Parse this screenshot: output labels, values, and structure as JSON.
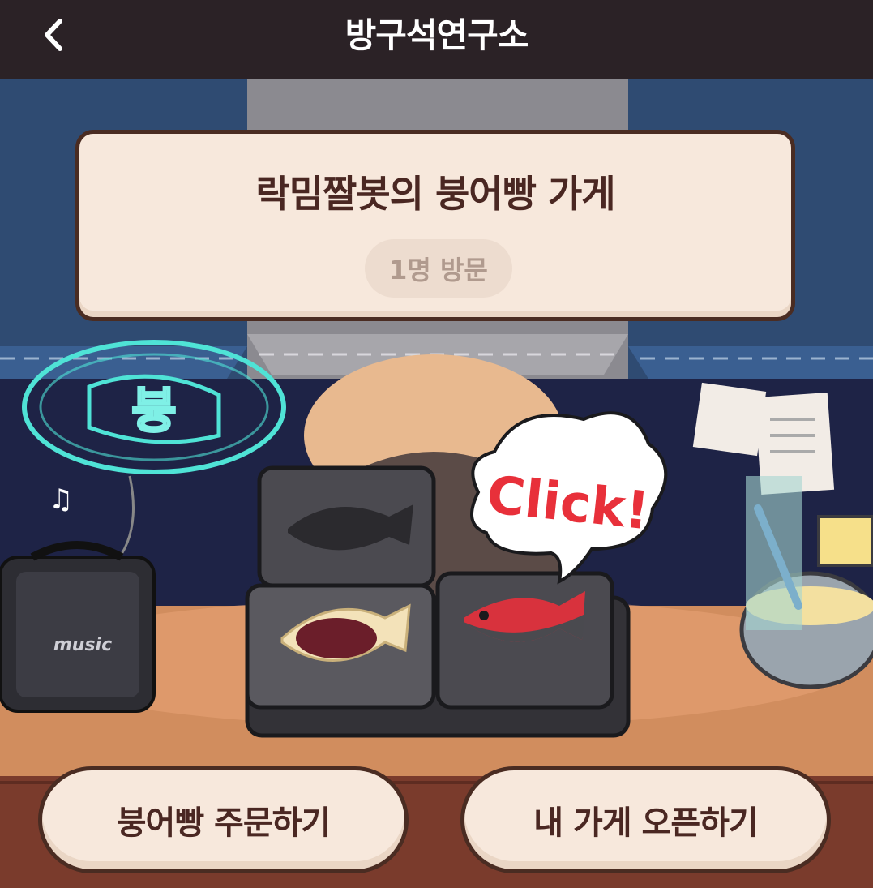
{
  "header": {
    "title": "방구석연구소",
    "back_icon": "chevron-left-icon"
  },
  "sign": {
    "store_name": "락밈짤봇의 붕어빵 가게",
    "visit_count": "1명 방문"
  },
  "scene": {
    "click_bubble": "Click!",
    "speaker_label": "music",
    "neon_text": "붕"
  },
  "buttons": {
    "order": "붕어빵 주문하기",
    "open_store": "내 가게 오픈하기"
  },
  "colors": {
    "topbar": "#2b2226",
    "sign_bg": "#f7e8dc",
    "sign_border": "#4a2c22",
    "text": "#4a2722",
    "click_red": "#e8303a",
    "neon": "#4fe3d6"
  }
}
